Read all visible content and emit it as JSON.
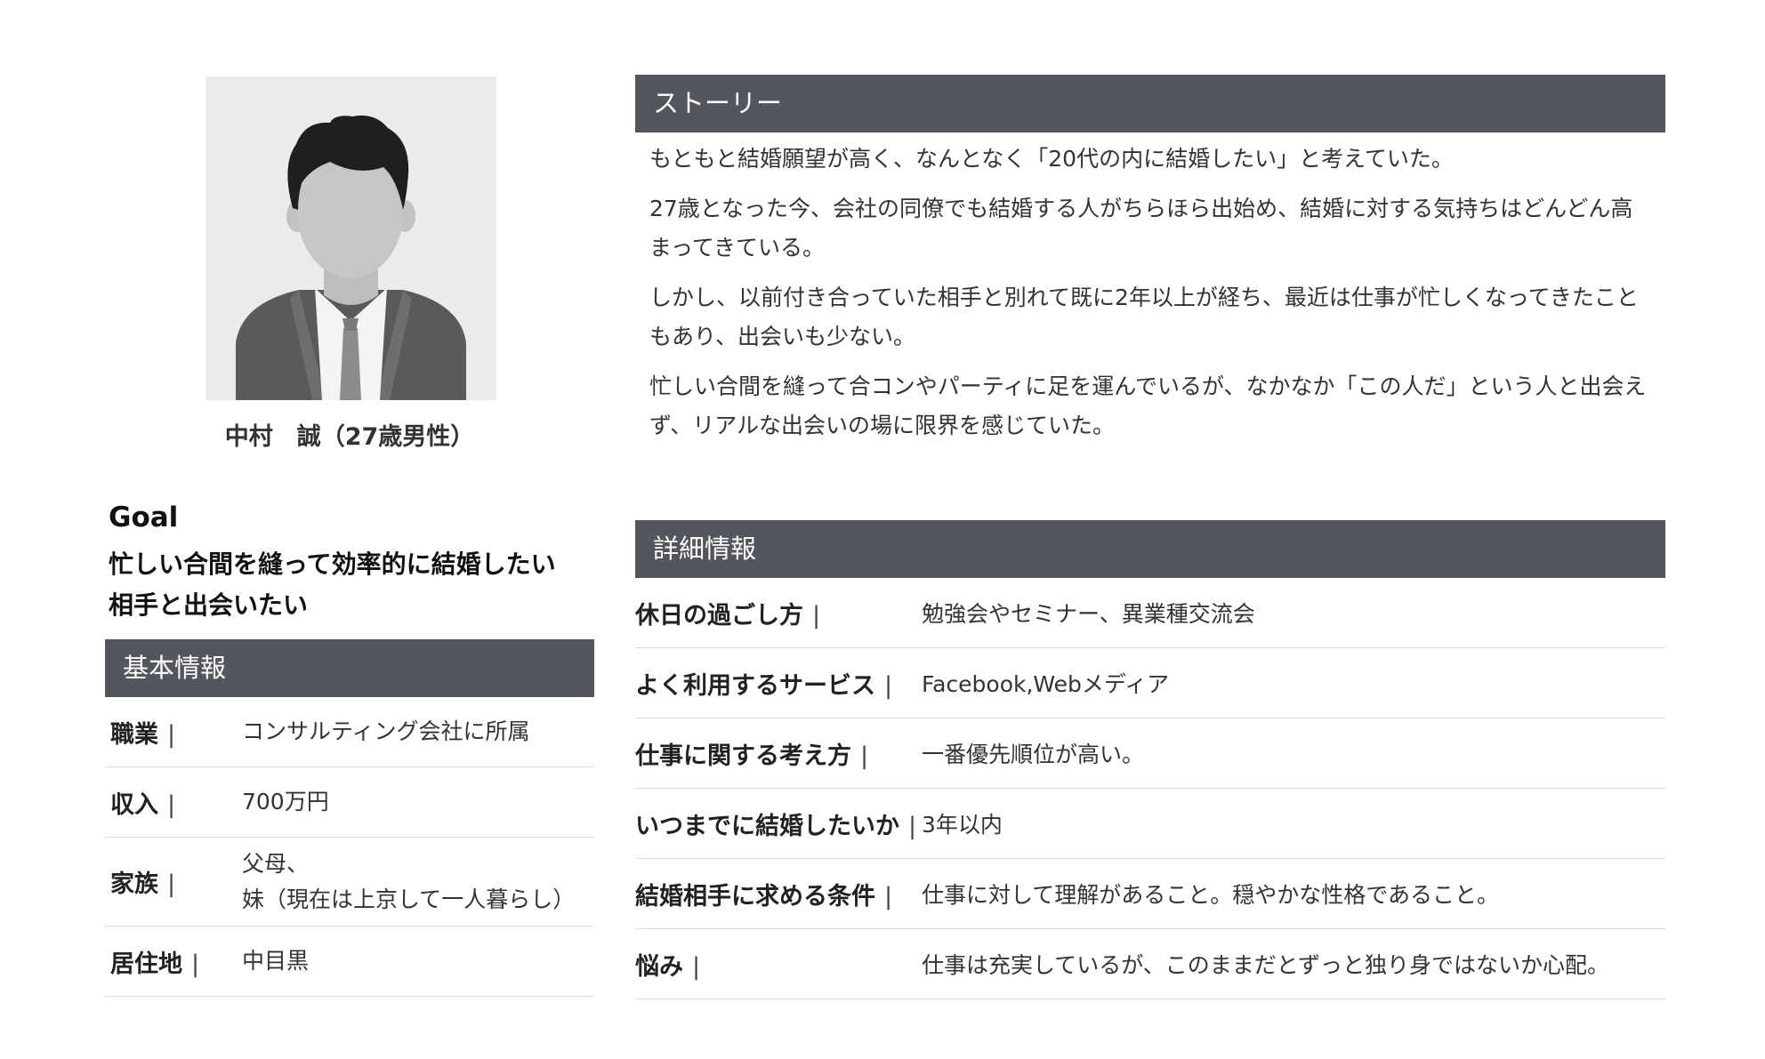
{
  "profile": {
    "name": "中村　誠（27歳男性）",
    "goal_label": "Goal",
    "goal_lines": [
      "忙しい合間を縫って効率的に結婚したい",
      "相手と出会いたい"
    ]
  },
  "basic_info": {
    "title": "基本情報",
    "rows": [
      {
        "label": "職業",
        "value": "コンサルティング会社に所属"
      },
      {
        "label": "収入",
        "value": "700万円"
      },
      {
        "label": "家族",
        "value_lines": [
          "父母、",
          "妹（現在は上京して一人暮らし）"
        ]
      },
      {
        "label": "居住地",
        "value": "中目黒"
      }
    ]
  },
  "story": {
    "title": "ストーリー",
    "paragraphs": [
      "もともと結婚願望が高く、なんとなく「20代の内に結婚したい」と考えていた。",
      "27歳となった今、会社の同僚でも結婚する人がちらほら出始め、結婚に対する気持ちはどんどん高まってきている。",
      "しかし、以前付き合っていた相手と別れて既に2年以上が経ち、最近は仕事が忙しくなってきたこともあり、出会いも少ない。",
      "忙しい合間を縫って合コンやパーティに足を運んでいるが、なかなか「この人だ」という人と出会えず、リアルな出会いの場に限界を感じていた。"
    ]
  },
  "details": {
    "title": "詳細情報",
    "separator": "|",
    "rows": [
      {
        "label": "休日の過ごし方",
        "value": "勉強会やセミナー、異業種交流会"
      },
      {
        "label": "よく利用するサービス",
        "value": "Facebook,Webメディア"
      },
      {
        "label": "仕事に関する考え方",
        "value": "一番優先順位が高い。"
      },
      {
        "label": "いつまでに結婚したいか",
        "value": "3年以内"
      },
      {
        "label": "結婚相手に求める条件",
        "value": "仕事に対して理解があること。穏やかな性格であること。"
      },
      {
        "label": "悩み",
        "value": "仕事は充実しているが、このままだとずっと独り身ではないか心配。"
      }
    ]
  }
}
